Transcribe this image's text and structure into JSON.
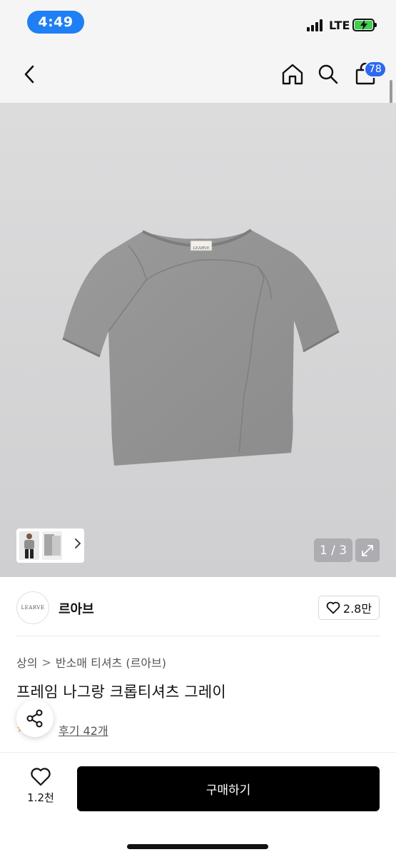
{
  "status_bar": {
    "time": "4:49",
    "network": "LTE",
    "battery_color": "#3fcf4e"
  },
  "nav": {
    "back_icon": "chevron-left-icon",
    "home_icon": "home-icon",
    "search_icon": "search-icon",
    "cart_icon": "shopping-bag-icon",
    "cart_count": "78",
    "badge_color": "#2d68f0"
  },
  "gallery": {
    "logo_label": "LEARVE",
    "page_counter": "1 / 3",
    "expand_icon": "expand-icon",
    "more_chevron_icon": "chevron-right-icon"
  },
  "brand": {
    "logo_text": "LEARVE",
    "name": "르아브",
    "likes": "2.8만"
  },
  "product": {
    "breadcrumb": [
      "상의",
      "반소매 티셔츠 (르아브)"
    ],
    "breadcrumb_separator": ">",
    "title": "프레임 나그랑 크롭티셔츠 그레이",
    "review_link": "후기 42개"
  },
  "bottom_bar": {
    "wish_count": "1.2천",
    "buy_label": "구매하기",
    "buy_color": "#000000"
  }
}
